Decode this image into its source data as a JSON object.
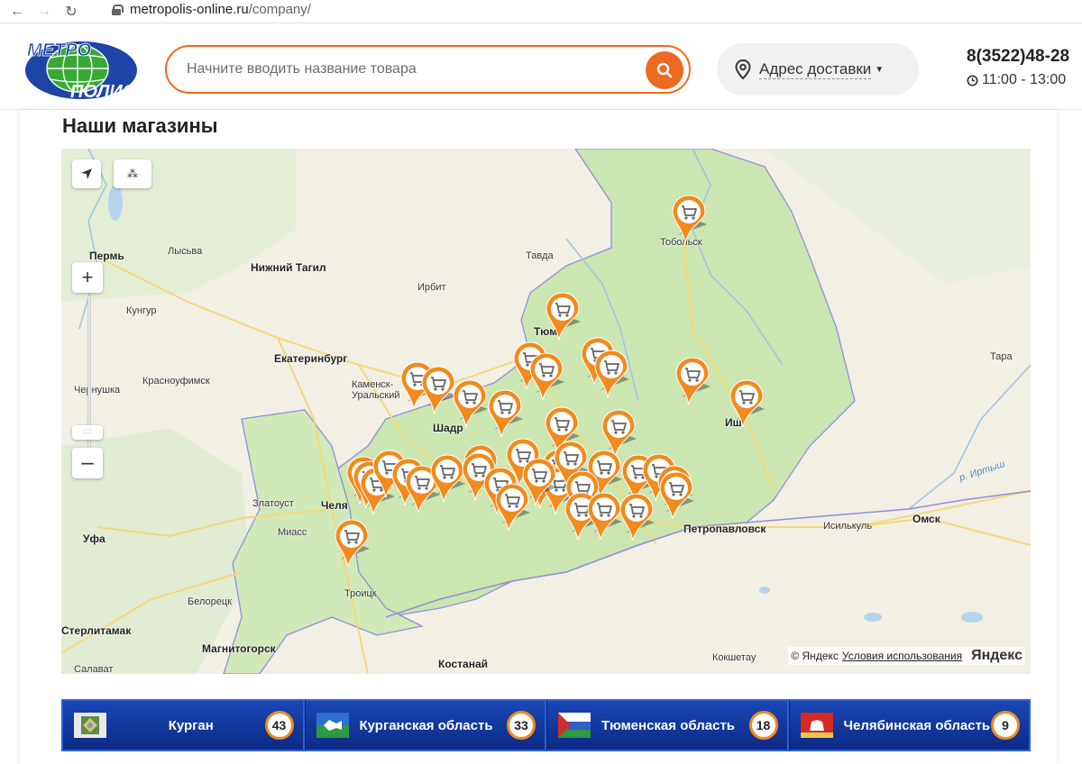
{
  "browser": {
    "url_host": "metropolis-online.ru",
    "url_path": "/company/"
  },
  "header": {
    "logo_text_top": "МЕТРО",
    "logo_text_bottom": "ПОЛИС",
    "search_placeholder": "Начните вводить название товара",
    "address_label": "Адрес доставки",
    "phone": "8(3522)48-28",
    "hours": "11:00 - 13:00"
  },
  "page": {
    "title": "Наши магазины"
  },
  "map": {
    "labels": {
      "perm": "Пермь",
      "lysva": "Лысьва",
      "n_tagil": "Нижний Тагил",
      "tavda": "Тавда",
      "tobolsk": "Тобольск",
      "irbit": "Ирбит",
      "kungur": "Кунгур",
      "tyumen": "Тюм",
      "ekb": "Екатеринбург",
      "kamensk": "Каменск-Уральский",
      "chernushka": "Чернушка",
      "krasnoufimsk": "Красноуфимск",
      "shadrinsk": "Шадр",
      "tara": "Тара",
      "ishim": "Иш",
      "zlatoust": "Златоуст",
      "chel": "Челя",
      "miass": "Миасс",
      "ufa": "Уфа",
      "petropavlovsk": "Петропавловск",
      "isilkul": "Исилькуль",
      "omsk": "Омск",
      "irtysh": "р. Иртыш",
      "troitsk": "Троицк",
      "beloretsk": "Белорецк",
      "sterlitamak": "Стерлитамак",
      "magnitogorsk": "Магнитогорск",
      "salavat": "Салават",
      "kostanay": "Костанай",
      "kokshetau": "Кокшетау"
    },
    "copyright": "© Яндекс",
    "terms": "Условия использования",
    "brand": "Яндекс"
  },
  "regions": [
    {
      "name": "Курган",
      "count": "43"
    },
    {
      "name": "Курганская область",
      "count": "33"
    },
    {
      "name": "Тюменская область",
      "count": "18"
    },
    {
      "name": "Челябинская область",
      "count": "9"
    }
  ],
  "colors": {
    "accent": "#ec6a21",
    "region_bg": "#1947b5",
    "badge_border": "#f28a1d",
    "map_region": "#cde7b4"
  }
}
